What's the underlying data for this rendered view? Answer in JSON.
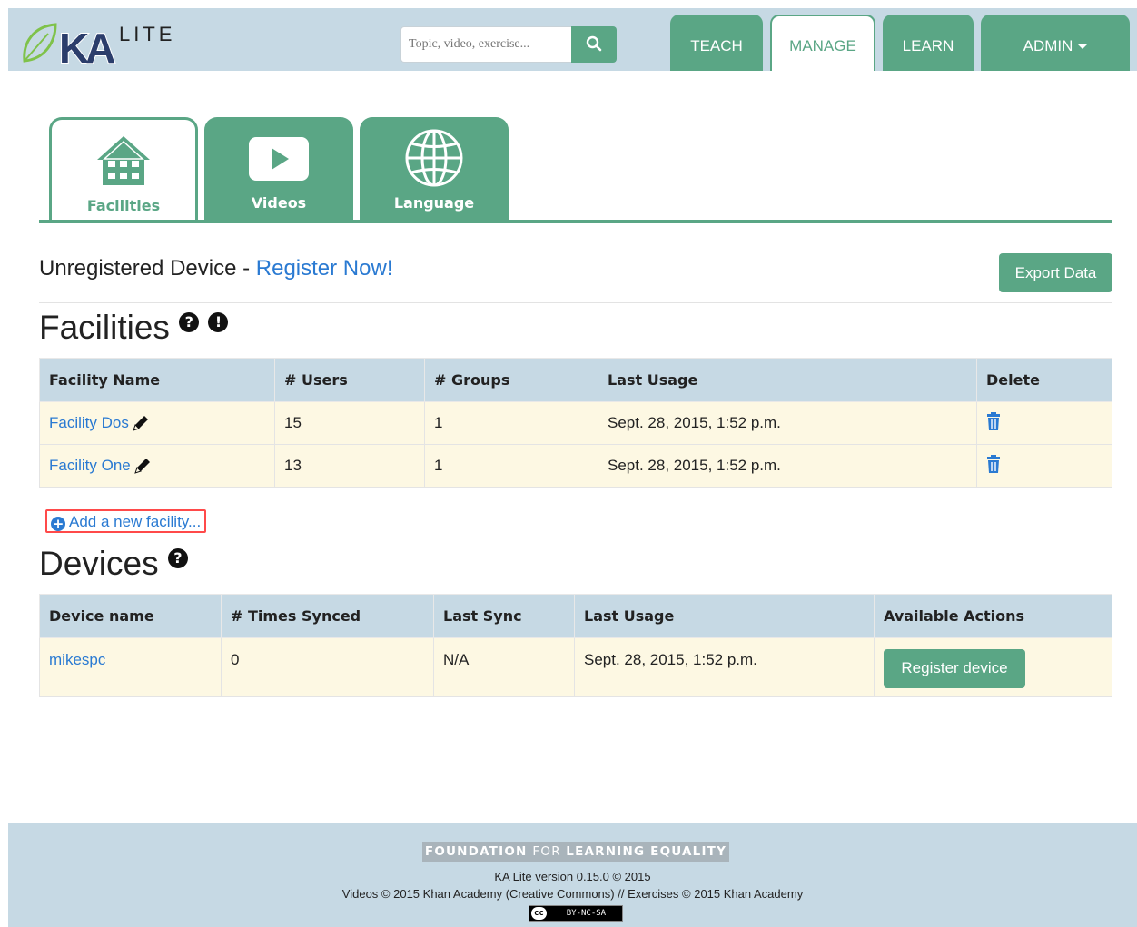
{
  "header": {
    "logo_text": "KA LITE",
    "search_placeholder": "Topic, video, exercise...",
    "nav": [
      "TEACH",
      "MANAGE",
      "LEARN",
      "ADMIN"
    ],
    "active_nav": "MANAGE"
  },
  "manage_tabs": [
    {
      "label": "Facilities",
      "icon": "house-icon",
      "active": true
    },
    {
      "label": "Videos",
      "icon": "play-icon",
      "active": false
    },
    {
      "label": "Language",
      "icon": "globe-icon",
      "active": false
    }
  ],
  "registration": {
    "status": "Unregistered Device - ",
    "link": "Register Now!"
  },
  "export_button": "Export Data",
  "facilities": {
    "title": "Facilities",
    "columns": [
      "Facility Name",
      "# Users",
      "# Groups",
      "Last Usage",
      "Delete"
    ],
    "rows": [
      {
        "name": "Facility Dos",
        "users": "15",
        "groups": "1",
        "last_usage": "Sept. 28, 2015, 1:52 p.m."
      },
      {
        "name": "Facility One",
        "users": "13",
        "groups": "1",
        "last_usage": "Sept. 28, 2015, 1:52 p.m."
      }
    ],
    "add_link": "Add a new facility..."
  },
  "devices": {
    "title": "Devices",
    "columns": [
      "Device name",
      "# Times Synced",
      "Last Sync",
      "Last Usage",
      "Available Actions"
    ],
    "rows": [
      {
        "name": "mikespc",
        "times_synced": "0",
        "last_sync": "N/A",
        "last_usage": "Sept. 28, 2015, 1:52 p.m.",
        "action": "Register device"
      }
    ]
  },
  "footer": {
    "org_bold1": "FOUNDATION ",
    "org_thin": "FOR ",
    "org_bold2": "LEARNING EQUALITY",
    "version": "KA Lite version 0.15.0 © 2015",
    "copyright": "Videos © 2015 Khan Academy (Creative Commons) // Exercises © 2015 Khan Academy",
    "license_cc": "cc",
    "license": "BY-NC-SA"
  },
  "colors": {
    "brand_green": "#5aa685",
    "header_bg": "#c6d9e4",
    "row_bg": "#fdf8e3",
    "link_blue": "#2a7ad2"
  }
}
